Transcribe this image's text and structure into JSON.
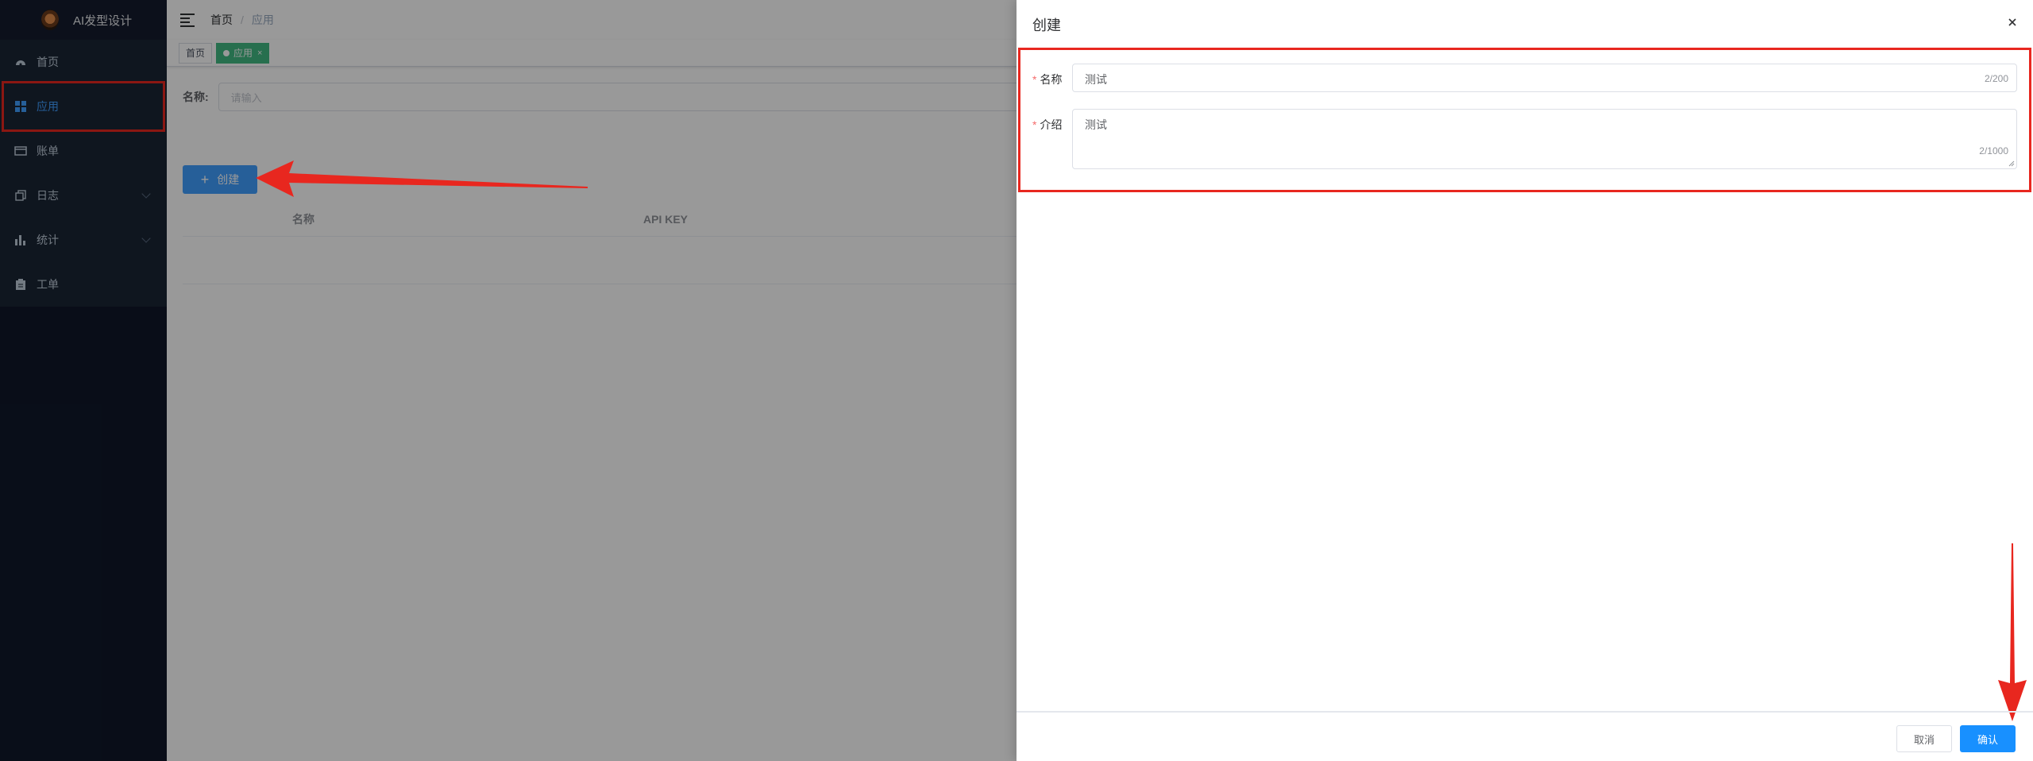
{
  "sidebar": {
    "app_title": "AI发型设计",
    "items": [
      {
        "label": "首页",
        "icon": "dashboard-icon"
      },
      {
        "label": "应用",
        "icon": "grid-icon",
        "active": true
      },
      {
        "label": "账单",
        "icon": "card-icon"
      },
      {
        "label": "日志",
        "icon": "copy-icon",
        "expandable": true
      },
      {
        "label": "统计",
        "icon": "bar-chart-icon",
        "expandable": true
      },
      {
        "label": "工单",
        "icon": "clipboard-icon"
      }
    ]
  },
  "header": {
    "breadcrumb": [
      "首页",
      "应用"
    ]
  },
  "tags": [
    {
      "label": "首页",
      "active": false
    },
    {
      "label": "应用",
      "active": true
    }
  ],
  "search": {
    "label": "名称:",
    "placeholder": "请输入"
  },
  "toolbar": {
    "create_label": "创建"
  },
  "table": {
    "columns": [
      "名称",
      "API KEY"
    ]
  },
  "drawer": {
    "title": "创建",
    "name_label": "名称",
    "name_value": "测试",
    "name_count": "2/200",
    "intro_label": "介绍",
    "intro_value": "测试",
    "intro_count": "2/1000",
    "cancel_label": "取消",
    "confirm_label": "确认"
  },
  "colors": {
    "primary": "#409eff",
    "confirm": "#1890ff",
    "tag_active": "#42b983",
    "annotation": "#e8271f",
    "sidebar_bg": "#1a2535"
  }
}
